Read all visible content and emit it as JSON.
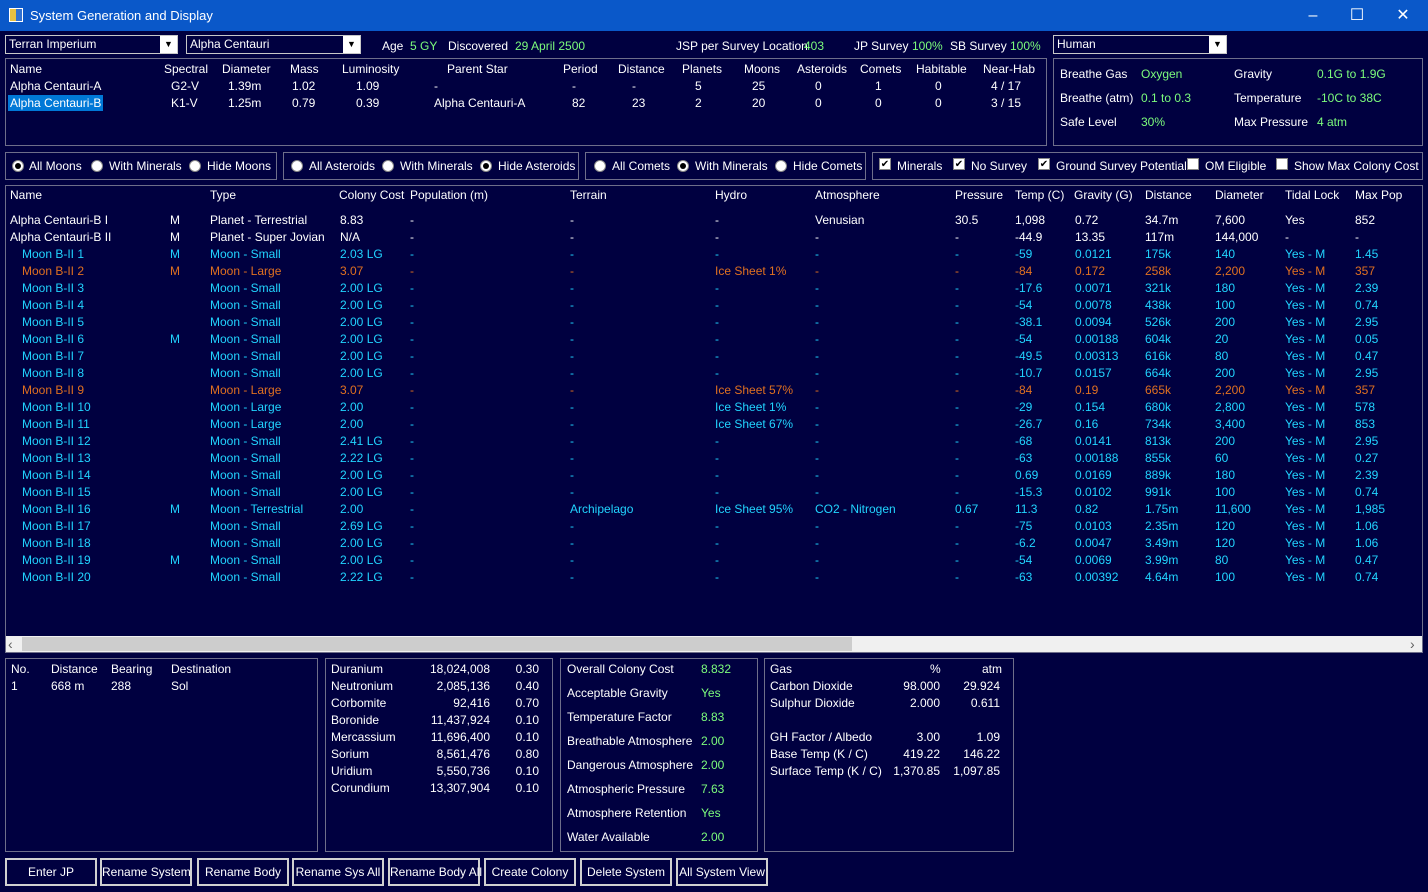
{
  "window": {
    "title": "System Generation and Display",
    "minimize": "–",
    "maximize": "☐",
    "close": "✕"
  },
  "top": {
    "race_select": "Terran Imperium",
    "system_select": "Alpha Centauri",
    "age_label": "Age",
    "age_value": "5 GY",
    "discovered_label": "Discovered",
    "discovered_value": "29 April 2500",
    "jsp_label": "JSP per Survey Location",
    "jsp_value": "403",
    "jp_survey_label": "JP Survey",
    "jp_survey_value": "100%",
    "sb_survey_label": "SB Survey",
    "sb_survey_value": "100%",
    "species_select": "Human"
  },
  "stars": {
    "headers": [
      "Name",
      "Spectral",
      "Diameter",
      "Mass",
      "Luminosity",
      "Parent Star",
      "Period",
      "Distance",
      "Planets",
      "Moons",
      "Asteroids",
      "Comets",
      "Habitable",
      "Near-Hab"
    ],
    "rows": [
      [
        "Alpha Centauri-A",
        "G2-V",
        "1.39m",
        "1.02",
        "1.09",
        "-",
        "-",
        "-",
        "5",
        "25",
        "0",
        "1",
        "0",
        "4 / 17"
      ],
      [
        "Alpha Centauri-B",
        "K1-V",
        "1.25m",
        "0.79",
        "0.39",
        "Alpha Centauri-A",
        "82",
        "23",
        "2",
        "20",
        "0",
        "0",
        "0",
        "3 / 15"
      ]
    ]
  },
  "env": {
    "breathe_gas_label": "Breathe Gas",
    "breathe_gas_value": "Oxygen",
    "breathe_atm_label": "Breathe (atm)",
    "breathe_atm_value": "0.1  to  0.3",
    "safe_level_label": "Safe Level",
    "safe_level_value": "30%",
    "gravity_label": "Gravity",
    "gravity_value": "0.1G  to  1.9G",
    "temperature_label": "Temperature",
    "temperature_value": "-10C  to  38C",
    "max_pressure_label": "Max Pressure",
    "max_pressure_value": "4 atm"
  },
  "filters": {
    "moons": [
      "All Moons",
      "With Minerals",
      "Hide Moons"
    ],
    "asteroids": [
      "All Asteroids",
      "With Minerals",
      "Hide Asteroids"
    ],
    "comets": [
      "All Comets",
      "With Minerals",
      "Hide Comets"
    ],
    "checks": [
      "Minerals",
      "No Survey",
      "Ground Survey Potential",
      "OM Eligible",
      "Show Max Colony Cost"
    ]
  },
  "bodies": {
    "headers": [
      "Name",
      "Type",
      "Colony Cost",
      "Population (m)",
      "Terrain",
      "Hydro",
      "Atmosphere",
      "Pressure",
      "Temp (C)",
      "Gravity (G)",
      "Distance",
      "Diameter",
      "Tidal Lock",
      "Max Pop"
    ],
    "rows": [
      {
        "c": "w",
        "name": "Alpha Centauri-B I",
        "m": "M",
        "type": "Planet - Terrestrial",
        "cost": "8.83",
        "pop": "-",
        "terrain": "-",
        "hydro": "-",
        "atmo": "Venusian",
        "pres": "30.5",
        "temp": "1,098",
        "grav": "0.72",
        "dist": "34.7m",
        "diam": "7,600",
        "tidal": "Yes",
        "maxpop": "852"
      },
      {
        "c": "w",
        "name": "Alpha Centauri-B II",
        "m": "M",
        "type": "Planet - Super Jovian",
        "cost": "N/A",
        "pop": "-",
        "terrain": "-",
        "hydro": "-",
        "atmo": "-",
        "pres": "-",
        "temp": "-44.9",
        "grav": "13.35",
        "dist": "117m",
        "diam": "144,000",
        "tidal": "-",
        "maxpop": "-"
      },
      {
        "c": "c",
        "name": "Moon B-II 1",
        "m": "M",
        "type": "Moon - Small",
        "cost": "2.03 LG",
        "pop": "-",
        "terrain": "-",
        "hydro": "-",
        "atmo": "-",
        "pres": "-",
        "temp": "-59",
        "grav": "0.0121",
        "dist": "175k",
        "diam": "140",
        "tidal": "Yes - M",
        "maxpop": "1.45"
      },
      {
        "c": "o",
        "name": "Moon B-II 2",
        "m": "M",
        "type": "Moon - Large",
        "cost": "3.07",
        "pop": "-",
        "terrain": "-",
        "hydro": "Ice Sheet 1%",
        "atmo": "-",
        "pres": "-",
        "temp": "-84",
        "grav": "0.172",
        "dist": "258k",
        "diam": "2,200",
        "tidal": "Yes - M",
        "maxpop": "357"
      },
      {
        "c": "c",
        "name": "Moon B-II 3",
        "m": "",
        "type": "Moon - Small",
        "cost": "2.00 LG",
        "pop": "-",
        "terrain": "-",
        "hydro": "-",
        "atmo": "-",
        "pres": "-",
        "temp": "-17.6",
        "grav": "0.0071",
        "dist": "321k",
        "diam": "180",
        "tidal": "Yes - M",
        "maxpop": "2.39"
      },
      {
        "c": "c",
        "name": "Moon B-II 4",
        "m": "",
        "type": "Moon - Small",
        "cost": "2.00 LG",
        "pop": "-",
        "terrain": "-",
        "hydro": "-",
        "atmo": "-",
        "pres": "-",
        "temp": "-54",
        "grav": "0.0078",
        "dist": "438k",
        "diam": "100",
        "tidal": "Yes - M",
        "maxpop": "0.74"
      },
      {
        "c": "c",
        "name": "Moon B-II 5",
        "m": "",
        "type": "Moon - Small",
        "cost": "2.00 LG",
        "pop": "-",
        "terrain": "-",
        "hydro": "-",
        "atmo": "-",
        "pres": "-",
        "temp": "-38.1",
        "grav": "0.0094",
        "dist": "526k",
        "diam": "200",
        "tidal": "Yes - M",
        "maxpop": "2.95"
      },
      {
        "c": "c",
        "name": "Moon B-II 6",
        "m": "M",
        "type": "Moon - Small",
        "cost": "2.00 LG",
        "pop": "-",
        "terrain": "-",
        "hydro": "-",
        "atmo": "-",
        "pres": "-",
        "temp": "-54",
        "grav": "0.00188",
        "dist": "604k",
        "diam": "20",
        "tidal": "Yes - M",
        "maxpop": "0.05"
      },
      {
        "c": "c",
        "name": "Moon B-II 7",
        "m": "",
        "type": "Moon - Small",
        "cost": "2.00 LG",
        "pop": "-",
        "terrain": "-",
        "hydro": "-",
        "atmo": "-",
        "pres": "-",
        "temp": "-49.5",
        "grav": "0.00313",
        "dist": "616k",
        "diam": "80",
        "tidal": "Yes - M",
        "maxpop": "0.47"
      },
      {
        "c": "c",
        "name": "Moon B-II 8",
        "m": "",
        "type": "Moon - Small",
        "cost": "2.00 LG",
        "pop": "-",
        "terrain": "-",
        "hydro": "-",
        "atmo": "-",
        "pres": "-",
        "temp": "-10.7",
        "grav": "0.0157",
        "dist": "664k",
        "diam": "200",
        "tidal": "Yes - M",
        "maxpop": "2.95"
      },
      {
        "c": "o",
        "name": "Moon B-II 9",
        "m": "",
        "type": "Moon - Large",
        "cost": "3.07",
        "pop": "-",
        "terrain": "-",
        "hydro": "Ice Sheet 57%",
        "atmo": "-",
        "pres": "-",
        "temp": "-84",
        "grav": "0.19",
        "dist": "665k",
        "diam": "2,200",
        "tidal": "Yes - M",
        "maxpop": "357"
      },
      {
        "c": "c",
        "name": "Moon B-II 10",
        "m": "",
        "type": "Moon - Large",
        "cost": "2.00",
        "pop": "-",
        "terrain": "-",
        "hydro": "Ice Sheet 1%",
        "atmo": "-",
        "pres": "-",
        "temp": "-29",
        "grav": "0.154",
        "dist": "680k",
        "diam": "2,800",
        "tidal": "Yes - M",
        "maxpop": "578"
      },
      {
        "c": "c",
        "name": "Moon B-II 11",
        "m": "",
        "type": "Moon - Large",
        "cost": "2.00",
        "pop": "-",
        "terrain": "-",
        "hydro": "Ice Sheet 67%",
        "atmo": "-",
        "pres": "-",
        "temp": "-26.7",
        "grav": "0.16",
        "dist": "734k",
        "diam": "3,400",
        "tidal": "Yes - M",
        "maxpop": "853"
      },
      {
        "c": "c",
        "name": "Moon B-II 12",
        "m": "",
        "type": "Moon - Small",
        "cost": "2.41 LG",
        "pop": "-",
        "terrain": "-",
        "hydro": "-",
        "atmo": "-",
        "pres": "-",
        "temp": "-68",
        "grav": "0.0141",
        "dist": "813k",
        "diam": "200",
        "tidal": "Yes - M",
        "maxpop": "2.95"
      },
      {
        "c": "c",
        "name": "Moon B-II 13",
        "m": "",
        "type": "Moon - Small",
        "cost": "2.22 LG",
        "pop": "-",
        "terrain": "-",
        "hydro": "-",
        "atmo": "-",
        "pres": "-",
        "temp": "-63",
        "grav": "0.00188",
        "dist": "855k",
        "diam": "60",
        "tidal": "Yes - M",
        "maxpop": "0.27"
      },
      {
        "c": "c",
        "name": "Moon B-II 14",
        "m": "",
        "type": "Moon - Small",
        "cost": "2.00 LG",
        "pop": "-",
        "terrain": "-",
        "hydro": "-",
        "atmo": "-",
        "pres": "-",
        "temp": "0.69",
        "grav": "0.0169",
        "dist": "889k",
        "diam": "180",
        "tidal": "Yes - M",
        "maxpop": "2.39"
      },
      {
        "c": "c",
        "name": "Moon B-II 15",
        "m": "",
        "type": "Moon - Small",
        "cost": "2.00 LG",
        "pop": "-",
        "terrain": "-",
        "hydro": "-",
        "atmo": "-",
        "pres": "-",
        "temp": "-15.3",
        "grav": "0.0102",
        "dist": "991k",
        "diam": "100",
        "tidal": "Yes - M",
        "maxpop": "0.74"
      },
      {
        "c": "c",
        "name": "Moon B-II 16",
        "m": "M",
        "type": "Moon - Terrestrial",
        "cost": "2.00",
        "pop": "-",
        "terrain": "Archipelago",
        "hydro": "Ice Sheet 95%",
        "atmo": "CO2 - Nitrogen",
        "pres": "0.67",
        "temp": "11.3",
        "grav": "0.82",
        "dist": "1.75m",
        "diam": "11,600",
        "tidal": "Yes - M",
        "maxpop": "1,985"
      },
      {
        "c": "c",
        "name": "Moon B-II 17",
        "m": "",
        "type": "Moon - Small",
        "cost": "2.69 LG",
        "pop": "-",
        "terrain": "-",
        "hydro": "-",
        "atmo": "-",
        "pres": "-",
        "temp": "-75",
        "grav": "0.0103",
        "dist": "2.35m",
        "diam": "120",
        "tidal": "Yes - M",
        "maxpop": "1.06"
      },
      {
        "c": "c",
        "name": "Moon B-II 18",
        "m": "",
        "type": "Moon - Small",
        "cost": "2.00 LG",
        "pop": "-",
        "terrain": "-",
        "hydro": "-",
        "atmo": "-",
        "pres": "-",
        "temp": "-6.2",
        "grav": "0.0047",
        "dist": "3.49m",
        "diam": "120",
        "tidal": "Yes - M",
        "maxpop": "1.06"
      },
      {
        "c": "c",
        "name": "Moon B-II 19",
        "m": "M",
        "type": "Moon - Small",
        "cost": "2.00 LG",
        "pop": "-",
        "terrain": "-",
        "hydro": "-",
        "atmo": "-",
        "pres": "-",
        "temp": "-54",
        "grav": "0.0069",
        "dist": "3.99m",
        "diam": "80",
        "tidal": "Yes - M",
        "maxpop": "0.47"
      },
      {
        "c": "c",
        "name": "Moon B-II 20",
        "m": "",
        "type": "Moon - Small",
        "cost": "2.22 LG",
        "pop": "-",
        "terrain": "-",
        "hydro": "-",
        "atmo": "-",
        "pres": "-",
        "temp": "-63",
        "grav": "0.00392",
        "dist": "4.64m",
        "diam": "100",
        "tidal": "Yes - M",
        "maxpop": "0.74"
      }
    ]
  },
  "jump": {
    "headers": [
      "No.",
      "Distance",
      "Bearing",
      "Destination"
    ],
    "rows": [
      [
        "1",
        "668 m",
        "288",
        "Sol"
      ]
    ]
  },
  "minerals": [
    [
      "Duranium",
      "18,024,008",
      "0.30"
    ],
    [
      "Neutronium",
      "2,085,136",
      "0.40"
    ],
    [
      "Corbomite",
      "92,416",
      "0.70"
    ],
    [
      "Boronide",
      "11,437,924",
      "0.10"
    ],
    [
      "Mercassium",
      "11,696,400",
      "0.10"
    ],
    [
      "Sorium",
      "8,561,476",
      "0.80"
    ],
    [
      "Uridium",
      "5,550,736",
      "0.10"
    ],
    [
      "Corundium",
      "13,307,904",
      "0.10"
    ]
  ],
  "colony": [
    [
      "Overall Colony Cost",
      "8.832"
    ],
    [
      "Acceptable Gravity",
      "Yes"
    ],
    [
      "Temperature Factor",
      "8.83"
    ],
    [
      "Breathable Atmosphere",
      "2.00"
    ],
    [
      "Dangerous Atmosphere",
      "2.00"
    ],
    [
      "Atmospheric Pressure",
      "7.63"
    ],
    [
      "Atmosphere Retention",
      "Yes"
    ],
    [
      "Water Available",
      "2.00"
    ]
  ],
  "gas": {
    "headers": [
      "Gas",
      "%",
      "atm"
    ],
    "rows": [
      [
        "Carbon Dioxide",
        "98.000",
        "29.924"
      ],
      [
        "Sulphur Dioxide",
        "2.000",
        "0.611"
      ]
    ],
    "extra": [
      [
        "GH Factor / Albedo",
        "3.00",
        "1.09"
      ],
      [
        "Base Temp (K / C)",
        "419.22",
        "146.22"
      ],
      [
        "Surface Temp (K / C)",
        "1,370.85",
        "1,097.85"
      ]
    ]
  },
  "buttons": [
    "Enter JP",
    "Rename System",
    "Rename Body",
    "Rename Sys All",
    "Rename Body All",
    "Create Colony",
    "Delete System",
    "All System View"
  ],
  "scroll": {
    "left": "‹",
    "right": "›"
  }
}
